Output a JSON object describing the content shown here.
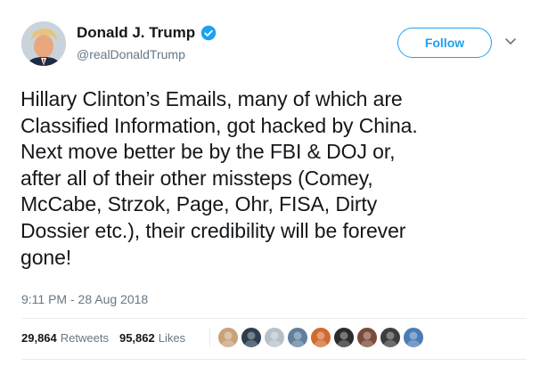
{
  "author": {
    "display_name": "Donald J. Trump",
    "handle": "@realDonaldTrump",
    "verified": true,
    "avatar_icon": "profile-photo-icon"
  },
  "actions": {
    "follow_label": "Follow",
    "menu_icon": "chevron-down-icon"
  },
  "tweet": {
    "text": "Hillary Clinton’s Emails, many of which are\nClassified Information, got hacked by China.\nNext move better be by the FBI & DOJ or,\nafter all of their other missteps (Comey,\nMcCabe, Strzok, Page, Ohr, FISA, Dirty\nDossier etc.), their credibility will be forever\ngone!",
    "timestamp": "9:11 PM - 28 Aug 2018"
  },
  "stats": {
    "retweets_count": "29,864",
    "retweets_label": "Retweets",
    "likes_count": "95,862",
    "likes_label": "Likes"
  },
  "likers": [
    {
      "icon": "liker-avatar-icon",
      "color": "#c8a27a"
    },
    {
      "icon": "liker-avatar-icon",
      "color": "#2c3e50"
    },
    {
      "icon": "liker-avatar-icon",
      "color": "#b7c0c8"
    },
    {
      "icon": "liker-avatar-icon",
      "color": "#5f7f9c"
    },
    {
      "icon": "liker-avatar-icon",
      "color": "#d06a2e"
    },
    {
      "icon": "liker-avatar-icon",
      "color": "#2b2b2b"
    },
    {
      "icon": "liker-avatar-icon",
      "color": "#7a4a3a"
    },
    {
      "icon": "liker-avatar-icon",
      "color": "#3d3d3d"
    },
    {
      "icon": "liker-avatar-icon",
      "color": "#4a7bb5"
    }
  ],
  "colors": {
    "accent": "#1da1f2",
    "text": "#14171a",
    "secondary_text": "#657786",
    "divider": "#e6ecf0"
  }
}
